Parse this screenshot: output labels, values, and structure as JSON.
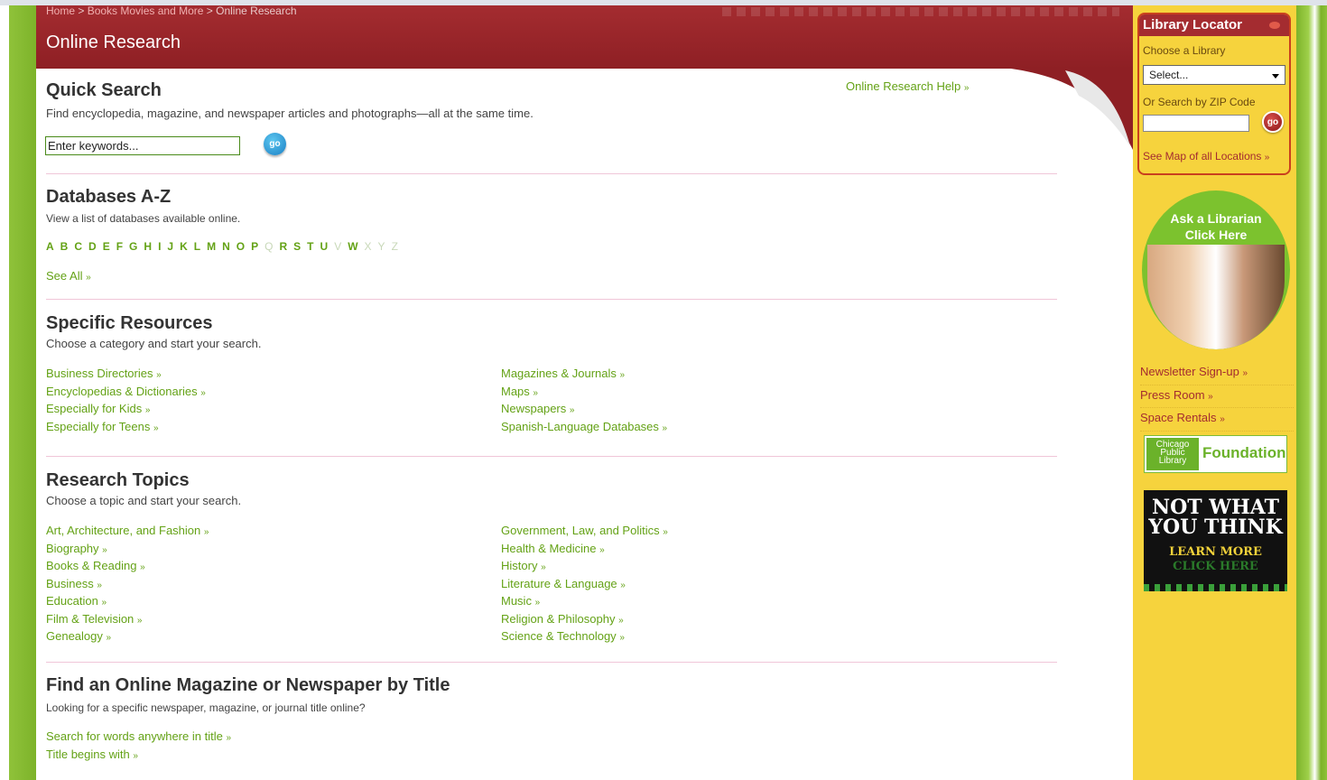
{
  "breadcrumb": {
    "home": "Home",
    "sep1": " > ",
    "books": "Books Movies and More",
    "sep2": " > ",
    "current": "Online Research"
  },
  "page_title": "Online Research",
  "quick_search": {
    "title": "Quick Search",
    "description": "Find encyclopedia, magazine, and newspaper articles and photographs—all at the same time.",
    "input_value": "Enter keywords...",
    "go_label": "go",
    "help_link": "Online Research Help"
  },
  "databases": {
    "title": "Databases A-Z",
    "description": "View a list of databases available online.",
    "letters": [
      {
        "l": "A",
        "on": true
      },
      {
        "l": "B",
        "on": true
      },
      {
        "l": "C",
        "on": true
      },
      {
        "l": "D",
        "on": true
      },
      {
        "l": "E",
        "on": true
      },
      {
        "l": "F",
        "on": true
      },
      {
        "l": "G",
        "on": true
      },
      {
        "l": "H",
        "on": true
      },
      {
        "l": "I",
        "on": true
      },
      {
        "l": "J",
        "on": true
      },
      {
        "l": "K",
        "on": true
      },
      {
        "l": "L",
        "on": true
      },
      {
        "l": "M",
        "on": true
      },
      {
        "l": "N",
        "on": true
      },
      {
        "l": "O",
        "on": true
      },
      {
        "l": "P",
        "on": true
      },
      {
        "l": "Q",
        "on": false
      },
      {
        "l": "R",
        "on": true
      },
      {
        "l": "S",
        "on": true
      },
      {
        "l": "T",
        "on": true
      },
      {
        "l": "U",
        "on": true
      },
      {
        "l": "V",
        "on": false
      },
      {
        "l": "W",
        "on": true
      },
      {
        "l": "X",
        "on": false
      },
      {
        "l": "Y",
        "on": false
      },
      {
        "l": "Z",
        "on": false
      }
    ],
    "see_all": "See All"
  },
  "specific": {
    "title": "Specific Resources",
    "description": "Choose a category and start your search.",
    "left": [
      "Business Directories",
      "Encyclopedias & Dictionaries",
      "Especially for Kids",
      "Especially for Teens"
    ],
    "right": [
      "Magazines & Journals",
      "Maps",
      "Newspapers",
      "Spanish-Language Databases"
    ]
  },
  "topics": {
    "title": "Research Topics",
    "description": "Choose a topic and start your search.",
    "left": [
      "Art, Architecture, and Fashion",
      "Biography",
      "Books & Reading",
      "Business",
      "Education",
      "Film & Television",
      "Genealogy"
    ],
    "right": [
      "Government, Law, and Politics",
      "Health & Medicine",
      "History",
      "Literature & Language",
      "Music",
      "Religion & Philosophy",
      "Science & Technology"
    ]
  },
  "find_title": {
    "title": "Find an Online Magazine or Newspaper by Title",
    "description": "Looking for a specific newspaper, magazine, or journal title online?",
    "links": [
      "Search for words anywhere in title",
      "Title begins with"
    ]
  },
  "raquo": "»",
  "sidebar": {
    "locator_title": "Library Locator",
    "choose_label": "Choose a Library",
    "select_value": "Select...",
    "zip_label": "Or Search by ZIP Code",
    "go_label": "go",
    "map_link": "See Map of all Locations",
    "ask_line1": "Ask a Librarian",
    "ask_line2": "Click Here",
    "links": [
      "Newsletter Sign-up",
      "Press Room",
      "Space Rentals"
    ],
    "foundation_logo": "Chicago Public Library",
    "foundation_text": "Foundation",
    "nwyt_line1": "NOT WHAT",
    "nwyt_line2": "YOU THINK",
    "nwyt_line3": "LEARN MORE",
    "nwyt_line4": "CLICK HERE"
  },
  "colors": {
    "header_red": "#a42c30",
    "link_green": "#64a216",
    "sidebar_yellow": "#f6d33d",
    "side_green": "#8fc23a"
  }
}
